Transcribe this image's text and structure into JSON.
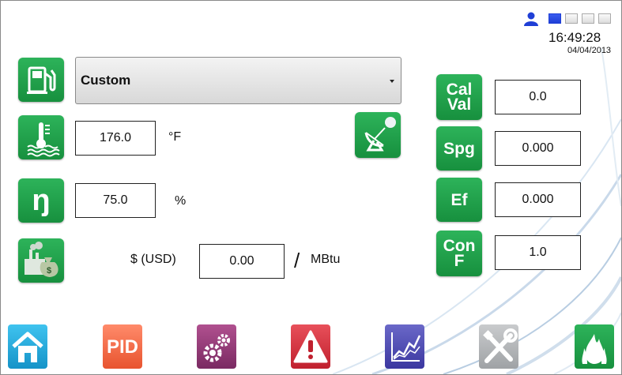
{
  "status": {
    "time": "16:49:28",
    "date": "04/04/2013",
    "user_icon": "user-icon",
    "level_squares": [
      "filled",
      "empty",
      "empty",
      "empty"
    ]
  },
  "fuel": {
    "icon": "fuel-pump-icon",
    "selected": "Custom"
  },
  "temperature": {
    "icon": "thermometer-icon",
    "value": "176.0",
    "unit": "°F"
  },
  "efficiency": {
    "icon": "eta-icon",
    "symbol": "ŋ",
    "value": "75.0",
    "unit": "%"
  },
  "cost": {
    "icon": "money-bag-factory-icon",
    "currency": "$ (USD)",
    "value": "0.00",
    "slash": "/",
    "unit": "MBtu"
  },
  "remote_icon": "satellite-dish-icon",
  "params": [
    {
      "label_line1": "Cal",
      "label_line2": "Val",
      "value": "0.0"
    },
    {
      "label_line1": "Spg",
      "label_line2": "",
      "value": "0.000"
    },
    {
      "label_line1": "Ef",
      "label_line2": "",
      "value": "0.000"
    },
    {
      "label_line1": "Con",
      "label_line2": "F",
      "value": "1.0"
    }
  ],
  "nav": [
    {
      "name": "home-icon",
      "label": ""
    },
    {
      "name": "pid-icon",
      "label": "PID"
    },
    {
      "name": "settings-gears-icon",
      "label": ""
    },
    {
      "name": "alarm-icon",
      "label": ""
    },
    {
      "name": "trend-chart-icon",
      "label": ""
    },
    {
      "name": "tools-icon",
      "label": ""
    },
    {
      "name": "flame-icon",
      "label": ""
    }
  ],
  "colors": {
    "accent_green": "#1fa24b",
    "status_blue": "#1f3fd6"
  }
}
